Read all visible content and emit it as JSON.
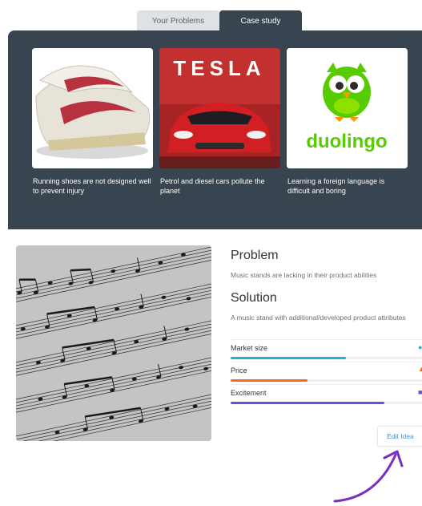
{
  "tabs": [
    {
      "label": "Your Problems",
      "active": false
    },
    {
      "label": "Case study",
      "active": true
    }
  ],
  "cards": [
    {
      "caption": "Running shoes are not designed well to prevent injury",
      "icon": "running-shoes-image"
    },
    {
      "caption": "Petrol and diesel cars pollute the planet",
      "icon": "tesla-car-image",
      "logo_text": "TESLA"
    },
    {
      "caption": "Learning a foreign language is difficult and boring",
      "icon": "duolingo-owl-image",
      "logo_text": "duolingo"
    }
  ],
  "detail": {
    "image": "sheet-music-image",
    "problem_heading": "Problem",
    "problem_text": "Music stands are lacking in their product abilities",
    "solution_heading": "Solution",
    "solution_text": "A music stand with additional/developed product attributes",
    "metrics": [
      {
        "label": "Market size",
        "value": 0.6,
        "color": "#22b3c8"
      },
      {
        "label": "Price",
        "value": 0.4,
        "color": "#f26a2a"
      },
      {
        "label": "Excitement",
        "value": 0.8,
        "color": "#6a4fd6"
      }
    ],
    "edit_label": "Edit Idea"
  },
  "colors": {
    "panel": "#384450",
    "arrow": "#7b2fbf"
  }
}
